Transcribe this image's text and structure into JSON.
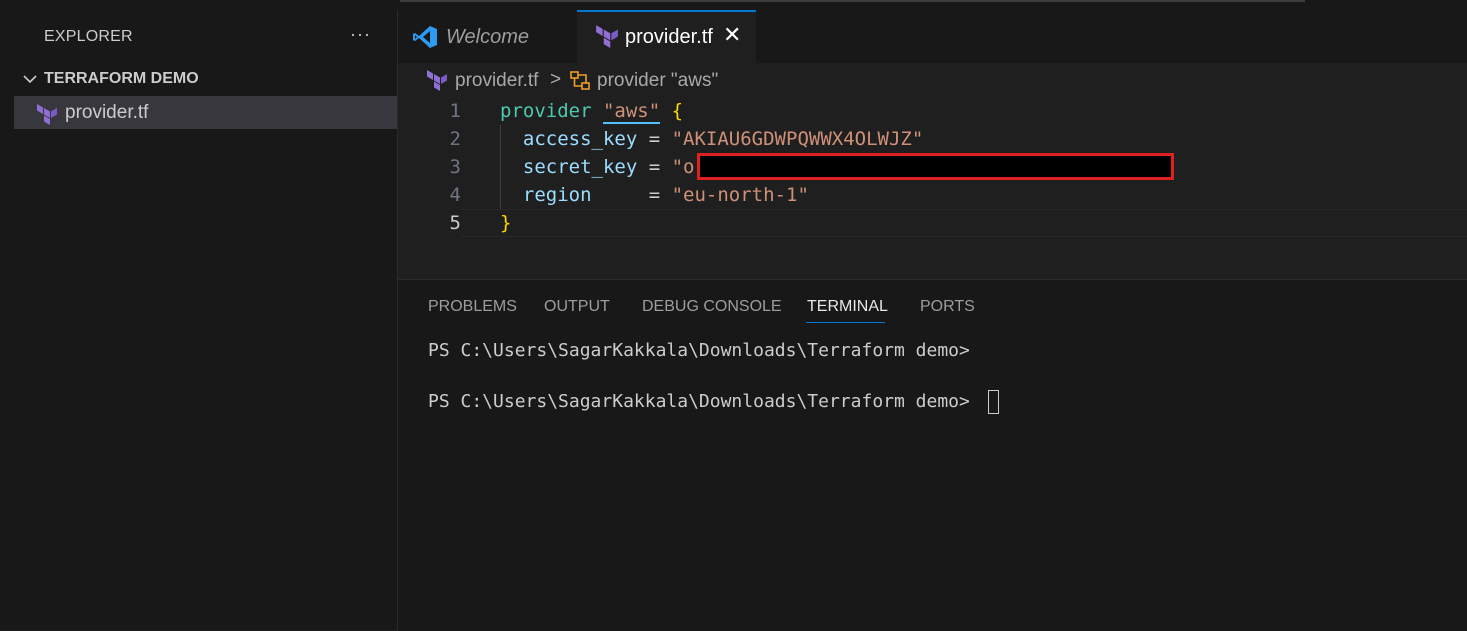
{
  "sidebar": {
    "title": "EXPLORER",
    "more_label": "···",
    "folder_name": "TERRAFORM DEMO",
    "files": [
      "provider.tf"
    ]
  },
  "tabs": [
    {
      "label": "Welcome",
      "icon": "vscode-icon",
      "active": false
    },
    {
      "label": "provider.tf",
      "icon": "terraform-icon",
      "active": true,
      "close": "✕"
    }
  ],
  "breadcrumb": {
    "file": "provider.tf",
    "separator": ">",
    "symbol": "provider \"aws\""
  },
  "editor": {
    "line_numbers": [
      "1",
      "2",
      "3",
      "4",
      "5"
    ],
    "current_line": "5",
    "code": {
      "l1_kw": "provider",
      "l1_str": "\"aws\"",
      "l1_brace": "{",
      "l2_attr": "access_key",
      "l2_eq": " = ",
      "l2_val": "\"AKIAU6GDWPQWWX4OLWJZ\"",
      "l3_attr": "secret_key",
      "l3_eq": " = ",
      "l3_val": "\"o",
      "l4_attr": "region",
      "l4_eq": "     = ",
      "l4_val": "\"eu-north-1\"",
      "l5_brace": "}"
    }
  },
  "panel": {
    "tabs": [
      "PROBLEMS",
      "OUTPUT",
      "DEBUG CONSOLE",
      "TERMINAL",
      "PORTS"
    ],
    "active_tab": "TERMINAL",
    "terminal_lines": [
      "PS C:\\Users\\SagarKakkala\\Downloads\\Terraform demo>",
      "PS C:\\Users\\SagarKakkala\\Downloads\\Terraform demo>"
    ]
  },
  "colors": {
    "accent": "#0078d4",
    "terraform": "#8f6fd1",
    "vscode_blue": "#2f9bf0",
    "redaction_border": "#e02020"
  }
}
